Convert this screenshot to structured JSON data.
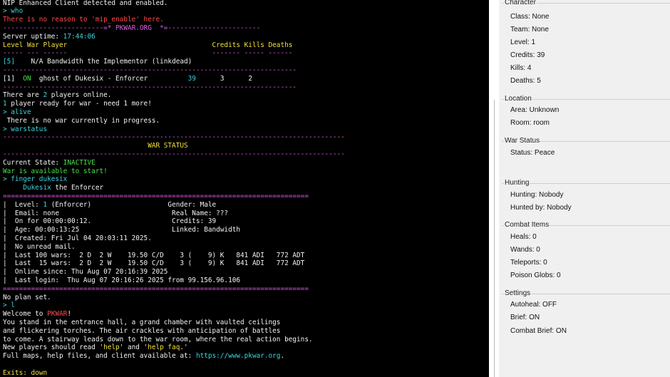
{
  "terminal": {
    "lines": [
      [
        {
          "t": "NIP Enhanced Client detected and enabled.",
          "c": "white"
        }
      ],
      [
        {
          "t": "> who",
          "c": "cyan"
        }
      ],
      [
        {
          "t": "There is no reason to 'mip_enable' here.",
          "c": "red"
        }
      ],
      [
        {
          "t": "-------------------------=* PKWAR.ORG  *=-----------------------",
          "c": "magenta"
        }
      ],
      [
        {
          "t": "Server uptime: ",
          "c": "white"
        },
        {
          "t": "17:44:06",
          "c": "cyan"
        }
      ],
      [
        {
          "t": "Level War Player                                    Credits Kills Deaths",
          "c": "yellow"
        }
      ],
      [
        {
          "t": "----- --- ------                                    ------- ----- ------",
          "c": "magenta"
        }
      ],
      [
        {
          "t": "[5]  ",
          "c": "cyan"
        },
        {
          "t": "  N/A Bandwidth the Implementor (linkdead)",
          "c": "white"
        }
      ],
      [
        {
          "t": "-------------------------------------------------------------------------",
          "c": "magenta"
        }
      ],
      [
        {
          "t": "[1]  ",
          "c": "white"
        },
        {
          "t": "ON ",
          "c": "green"
        },
        {
          "t": " ghost of Dukesix - Enforcer          ",
          "c": "white"
        },
        {
          "t": "39",
          "c": "cyan"
        },
        {
          "t": "      3      2",
          "c": "white"
        }
      ],
      [
        {
          "t": "-------------------------------------------------------------------------",
          "c": "magenta"
        }
      ],
      [
        {
          "t": "There are ",
          "c": "white"
        },
        {
          "t": "2",
          "c": "cyan"
        },
        {
          "t": " players online.",
          "c": "white"
        }
      ],
      [
        {
          "t": "1",
          "c": "cyan"
        },
        {
          "t": " player ready for war - need 1 more!",
          "c": "white"
        }
      ],
      [
        {
          "t": "> alive",
          "c": "cyan"
        }
      ],
      [
        {
          "t": " There is no war currently in progress.",
          "c": "white"
        }
      ],
      [
        {
          "t": "> warstatus",
          "c": "cyan"
        }
      ],
      [
        {
          "t": "-------------------------------------------------------------------------------------",
          "c": "magenta"
        }
      ],
      [
        {
          "t": "                                    WAR STATUS",
          "c": "yellow"
        }
      ],
      [
        {
          "t": "-------------------------------------------------------------------------------------",
          "c": "magenta"
        }
      ],
      [
        {
          "t": "Current State: ",
          "c": "white"
        },
        {
          "t": "INACTIVE",
          "c": "green"
        }
      ],
      [
        {
          "t": "War is available to start!",
          "c": "green"
        }
      ],
      [
        {
          "t": "> finger dukesix",
          "c": "cyan"
        }
      ],
      [
        {
          "t": "     Dukesix",
          "c": "cyan"
        },
        {
          "t": " the Enforcer",
          "c": "white"
        }
      ],
      [
        {
          "t": "============================================================================",
          "c": "magenta"
        }
      ],
      [
        {
          "t": "|  Level: ",
          "c": "white"
        },
        {
          "t": "1",
          "c": "cyan"
        },
        {
          "t": " (Enforcer)                   Gender: Male",
          "c": "white"
        }
      ],
      [
        {
          "t": "|  Email: none                            Real Name: ???",
          "c": "white"
        }
      ],
      [
        {
          "t": "|  On for 00:00:00:12.                    Credits: 39",
          "c": "white"
        }
      ],
      [
        {
          "t": "|  Age: 00:00:13:25                       Linked: Bandwidth",
          "c": "white"
        }
      ],
      [
        {
          "t": "|  Created: Fri Jul 04 20:03:11 2025.",
          "c": "white"
        }
      ],
      [
        {
          "t": "|  No unread mail.",
          "c": "white"
        }
      ],
      [
        {
          "t": "|  Last 100 wars:  2 D  2 W    19.50 C/D    3 (    9) K   841 ADI   772 ADT",
          "c": "white"
        }
      ],
      [
        {
          "t": "|  Last  15 wars:  2 D  2 W    19.50 C/D    3 (    9) K   841 ADI   772 ADT",
          "c": "white"
        }
      ],
      [
        {
          "t": "|  Online since: Thu Aug 07 20:16:39 2025",
          "c": "white"
        }
      ],
      [
        {
          "t": "|  Last login:  Thu Aug 07 20:16:26 2025 from 99.156.96.106",
          "c": "white"
        }
      ],
      [
        {
          "t": "============================================================================",
          "c": "magenta"
        }
      ],
      [
        {
          "t": "No plan set.",
          "c": "white"
        }
      ],
      [
        {
          "t": "> l",
          "c": "cyan"
        }
      ],
      [
        {
          "t": "Welcome to ",
          "c": "white"
        },
        {
          "t": "PKWAR",
          "c": "red"
        },
        {
          "t": "!",
          "c": "white"
        }
      ],
      [
        {
          "t": "You stand in the entrance hall, a grand chamber with vaulted ceilings",
          "c": "white"
        }
      ],
      [
        {
          "t": "and flickering torches. The air crackles with anticipation of battles",
          "c": "white"
        }
      ],
      [
        {
          "t": "to come. A stairway leads down to the war room, where the real action begins.",
          "c": "white"
        }
      ],
      [
        {
          "t": "New players should read '",
          "c": "white"
        },
        {
          "t": "help",
          "c": "yellow"
        },
        {
          "t": "' and '",
          "c": "white"
        },
        {
          "t": "help faq",
          "c": "yellow"
        },
        {
          "t": ".'",
          "c": "white"
        }
      ],
      [
        {
          "t": "Full maps, help files, and client available at: ",
          "c": "white"
        },
        {
          "t": "https://www.pkwar.org",
          "c": "cyan"
        },
        {
          "t": ".",
          "c": "white"
        }
      ],
      [
        {
          "t": "",
          "c": "white"
        }
      ],
      [
        {
          "t": "Exits: down",
          "c": "yellow"
        }
      ]
    ]
  },
  "sidebar": {
    "groups": [
      {
        "title": "Character",
        "items": [
          "Class: None",
          "Team: None",
          "Level: 1",
          "Credits: 39",
          "Kills: 4",
          "Deaths: 5"
        ]
      },
      {
        "title": "Location",
        "items": [
          "Area: Unknown",
          "Room: room"
        ]
      },
      {
        "title": "War Status",
        "items": [
          "Status: Peace"
        ]
      },
      {
        "title": "Hunting",
        "items": [
          "Hunting: Nobody",
          "Hunted by: Nobody"
        ]
      },
      {
        "title": "Combat Items",
        "items": [
          "Heals: 0",
          "Wands: 0",
          "Teleports: 0",
          "Poison Globs: 0"
        ]
      },
      {
        "title": "Settings",
        "items": [
          "Autoheal: OFF",
          "Brief: ON",
          "Combat Brief: ON"
        ]
      }
    ]
  }
}
